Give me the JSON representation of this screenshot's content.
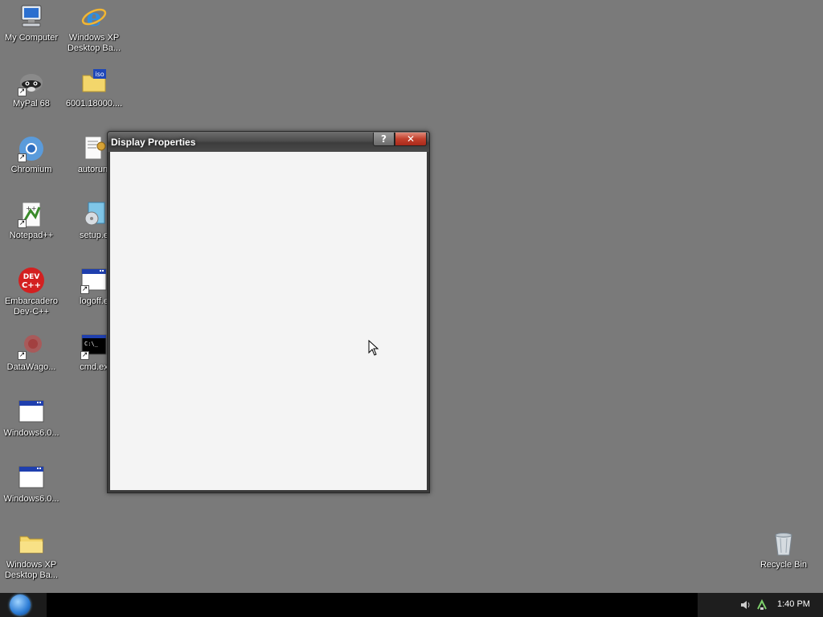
{
  "desktop": {
    "icons": [
      {
        "label": "My Computer",
        "icon": "computer-icon"
      },
      {
        "label": "Windows XP\nDesktop Ba...",
        "icon": "internet-explorer-icon"
      },
      {
        "label": "MyPal 68",
        "icon": "mypal-raccoon-icon"
      },
      {
        "label": "6001.18000....",
        "icon": "iso-folder-icon"
      },
      {
        "label": "Chromium",
        "icon": "chromium-icon"
      },
      {
        "label": "autorun.",
        "icon": "autorun-settings-icon"
      },
      {
        "label": "Notepad++",
        "icon": "notepadpp-icon"
      },
      {
        "label": "setup.e",
        "icon": "setup-installer-icon"
      },
      {
        "label": "Embarcadero\nDev-C++",
        "icon": "devcpp-icon"
      },
      {
        "label": "logoff.e",
        "icon": "application-window-icon"
      },
      {
        "label": "DataWago...",
        "icon": "datawagon-icon"
      },
      {
        "label": "cmd.ex",
        "icon": "command-prompt-icon"
      },
      {
        "label": "Windows6.0...",
        "icon": "application-window-icon"
      },
      {
        "label": "Windows6.0...",
        "icon": "application-window-icon"
      },
      {
        "label": "Windows XP\nDesktop Ba...",
        "icon": "folder-icon"
      },
      {
        "label": "Recycle Bin",
        "icon": "recycle-bin-icon"
      }
    ]
  },
  "dialog": {
    "title": "Display Properties",
    "help_label": "?",
    "close_label": "✕"
  },
  "taskbar": {
    "clock": "1:40 PM"
  },
  "colors": {
    "desktop_bg": "#7a7a7a",
    "dialog_client_bg": "#f4f4f4",
    "close_button_red": "#c2402c",
    "taskbar_bg": "#000000"
  }
}
